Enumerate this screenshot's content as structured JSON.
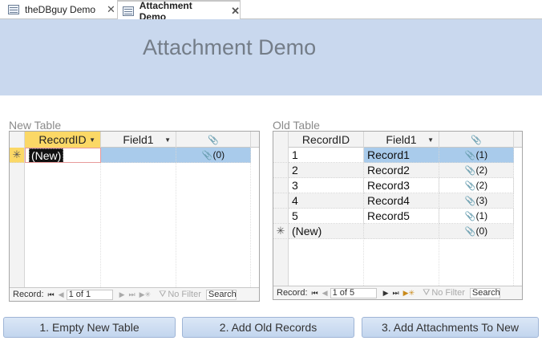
{
  "tabs": [
    {
      "label": "theDBguy Demo",
      "close": "✕"
    },
    {
      "label": "Attachment Demo",
      "close": "✕"
    }
  ],
  "header": {
    "title": "Attachment Demo"
  },
  "new_table": {
    "caption": "New Table",
    "columns": [
      "RecordID",
      "Field1",
      "📎"
    ],
    "rows": [
      {
        "selector": "✳",
        "record_id": "(New)",
        "field1": "",
        "attachments": "(0)"
      }
    ],
    "nav": {
      "label": "Record:",
      "position": "1 of 1",
      "filter": "No Filter",
      "search": "Search"
    }
  },
  "old_table": {
    "caption": "Old Table",
    "columns": [
      "RecordID",
      "Field1",
      "📎"
    ],
    "rows": [
      {
        "selector": "",
        "record_id": "1",
        "field1": "Record1",
        "attachments": "(1)"
      },
      {
        "selector": "",
        "record_id": "2",
        "field1": "Record2",
        "attachments": "(2)"
      },
      {
        "selector": "",
        "record_id": "3",
        "field1": "Record3",
        "attachments": "(2)"
      },
      {
        "selector": "",
        "record_id": "4",
        "field1": "Record4",
        "attachments": "(3)"
      },
      {
        "selector": "",
        "record_id": "5",
        "field1": "Record5",
        "attachments": "(1)"
      },
      {
        "selector": "✳",
        "record_id": "(New)",
        "field1": "",
        "attachments": "(0)"
      }
    ],
    "nav": {
      "label": "Record:",
      "position": "1 of 5",
      "filter": "No Filter",
      "search": "Search"
    }
  },
  "buttons": {
    "empty_new": "1. Empty New Table",
    "add_old": "2. Add Old Records",
    "add_attach": "3. Add Attachments To New"
  },
  "glyphs": {
    "paperclip": "📎",
    "first": "⏮",
    "prev": "◀",
    "next": "▶",
    "last": "⏭",
    "new_record": "▶✳",
    "filter": "⛛"
  }
}
